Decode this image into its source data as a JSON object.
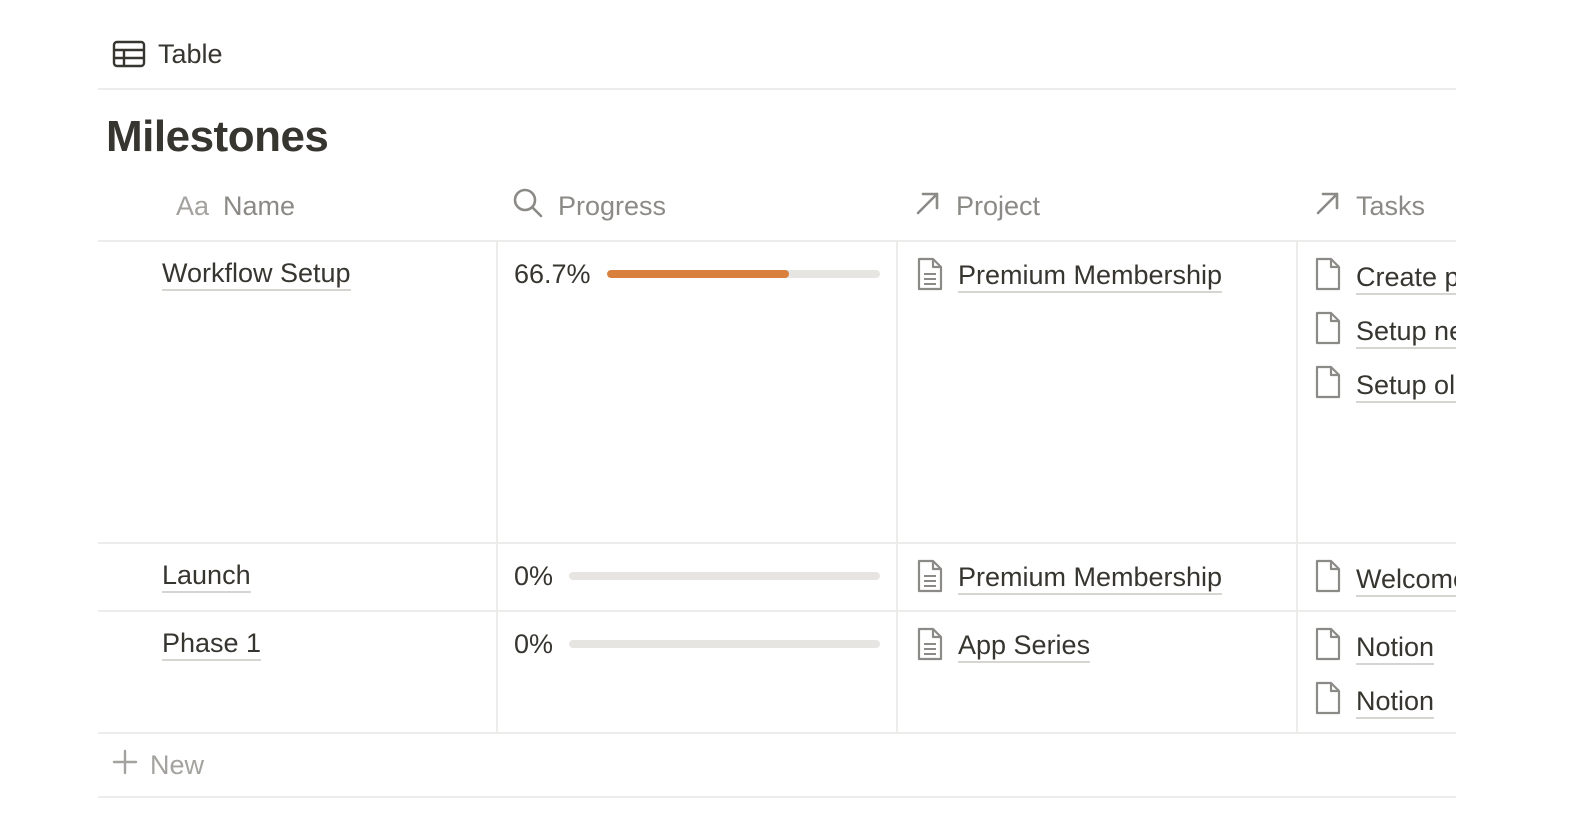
{
  "view": {
    "icon": "table-icon",
    "label": "Table"
  },
  "database": {
    "title": "Milestones"
  },
  "columns": [
    {
      "icon": "text-property-icon",
      "icon_text": "Aa",
      "label": "Name"
    },
    {
      "icon": "search-icon",
      "label": "Progress"
    },
    {
      "icon": "relation-arrow-icon",
      "label": "Project"
    },
    {
      "icon": "relation-arrow-icon",
      "label": "Tasks"
    }
  ],
  "rows": [
    {
      "name": "Workflow Setup",
      "progress_label": "66.7%",
      "progress_value": 0.667,
      "project": "Premium Membership",
      "tasks": [
        "Create page design",
        "Setup new payment flow",
        "Setup old members"
      ]
    },
    {
      "name": "Launch",
      "progress_label": "0%",
      "progress_value": 0,
      "project": "Premium Membership",
      "tasks": [
        "Welcome"
      ]
    },
    {
      "name": "Phase 1",
      "progress_label": "0%",
      "progress_value": 0,
      "project": "App Series",
      "tasks": [
        "Notion",
        "Notion"
      ]
    }
  ],
  "new_row": {
    "label": "New"
  },
  "colors": {
    "progress_fill": "#d9803d",
    "progress_track": "#e6e5e2",
    "text": "#37352f",
    "muted": "#8c8a86"
  }
}
